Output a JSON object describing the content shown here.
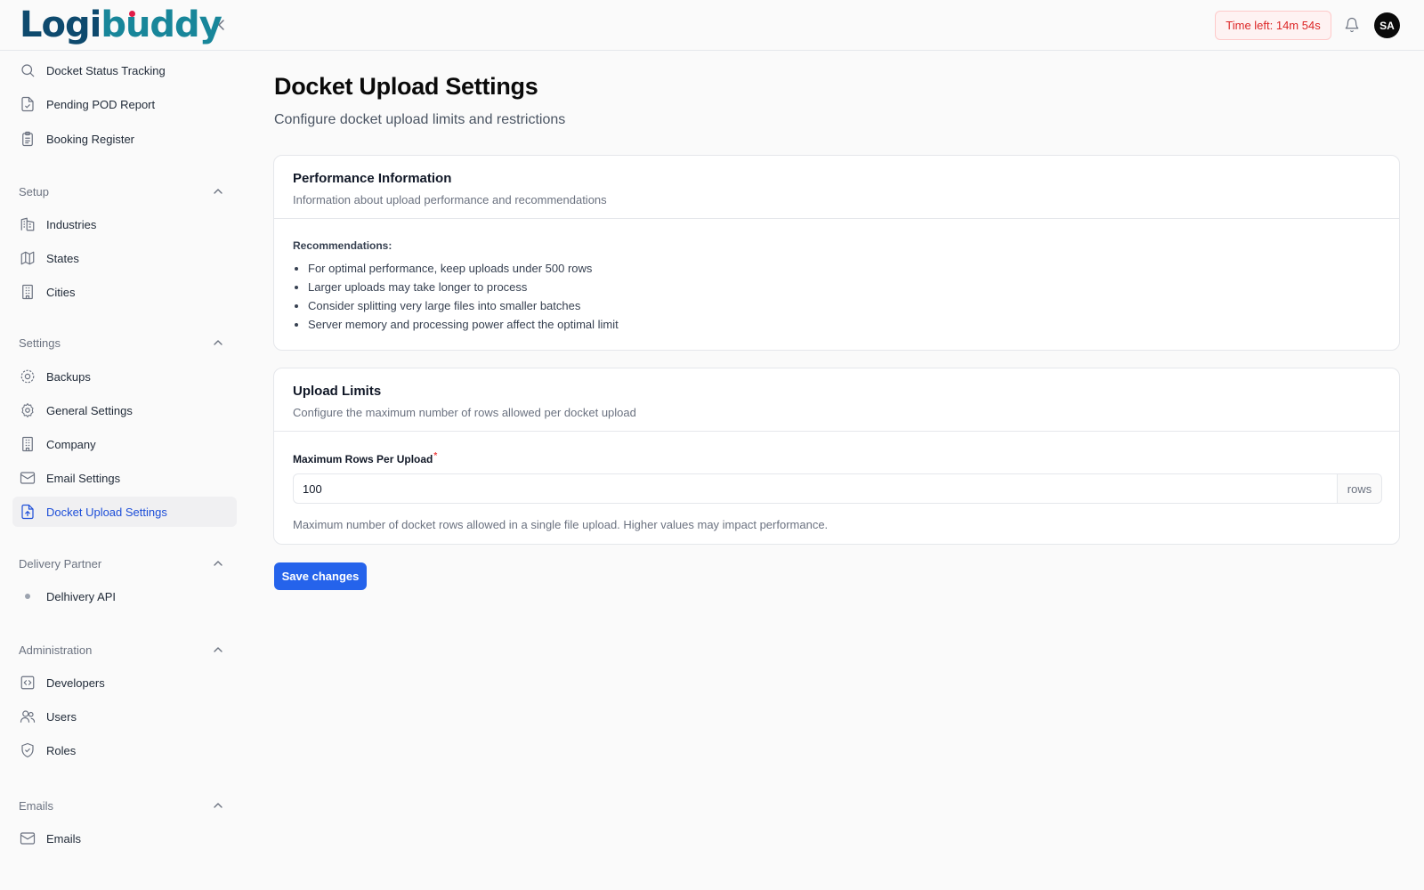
{
  "app": {
    "logo_part1": "Logi",
    "logo_part2": "buddy",
    "timer": "Time left: 14m 54s",
    "avatar_initials": "SA"
  },
  "sidebar": {
    "top_items": [
      {
        "label": "Docket Status Tracking",
        "icon": "search-icon"
      },
      {
        "label": "Pending POD Report",
        "icon": "file-check-icon"
      },
      {
        "label": "Booking Register",
        "icon": "clipboard-icon"
      }
    ],
    "sections": {
      "setup": {
        "title": "Setup",
        "items": [
          {
            "label": "Industries",
            "icon": "building-icon"
          },
          {
            "label": "States",
            "icon": "map-icon"
          },
          {
            "label": "Cities",
            "icon": "city-icon"
          }
        ]
      },
      "settings": {
        "title": "Settings",
        "items": [
          {
            "label": "Backups",
            "icon": "backup-icon"
          },
          {
            "label": "General Settings",
            "icon": "gear-icon"
          },
          {
            "label": "Company",
            "icon": "company-icon"
          },
          {
            "label": "Email Settings",
            "icon": "mail-icon"
          },
          {
            "label": "Docket Upload Settings",
            "icon": "file-upload-icon",
            "active": true
          }
        ]
      },
      "delivery_partner": {
        "title": "Delivery Partner",
        "items": [
          {
            "label": "Delhivery API",
            "icon": "dot-icon"
          }
        ]
      },
      "administration": {
        "title": "Administration",
        "items": [
          {
            "label": "Developers",
            "icon": "code-icon"
          },
          {
            "label": "Users",
            "icon": "users-icon"
          },
          {
            "label": "Roles",
            "icon": "shield-icon"
          }
        ]
      },
      "emails": {
        "title": "Emails",
        "items": [
          {
            "label": "Emails",
            "icon": "mail-icon"
          }
        ]
      }
    }
  },
  "main": {
    "title": "Docket Upload Settings",
    "subtitle": "Configure docket upload limits and restrictions",
    "performance": {
      "title": "Performance Information",
      "description": "Information about upload performance and recommendations",
      "rec_title": "Recommendations:",
      "recommendations": [
        "For optimal performance, keep uploads under 500 rows",
        "Larger uploads may take longer to process",
        "Consider splitting very large files into smaller batches",
        "Server memory and processing power affect the optimal limit"
      ]
    },
    "upload_limits": {
      "title": "Upload Limits",
      "description": "Configure the maximum number of rows allowed per docket upload",
      "field_label": "Maximum Rows Per Upload",
      "required_mark": "*",
      "value": "100",
      "suffix": "rows",
      "help": "Maximum number of docket rows allowed in a single file upload. Higher values may impact performance."
    },
    "save_label": "Save changes"
  },
  "colors": {
    "accent": "#2563eb",
    "active_text": "#1d4ed8",
    "timer_text": "#dc2626",
    "timer_bg": "#fef2f2"
  }
}
